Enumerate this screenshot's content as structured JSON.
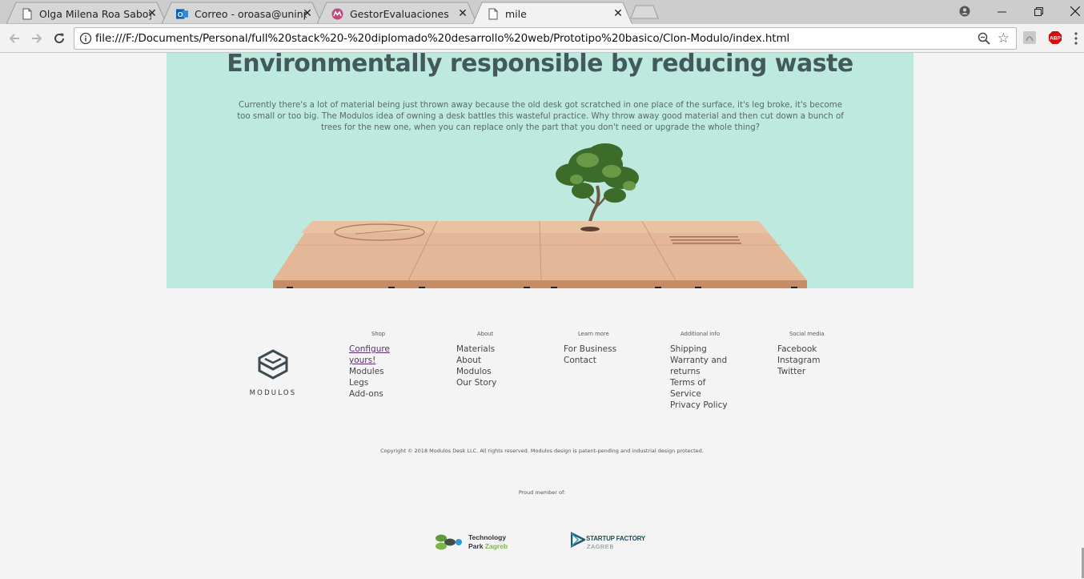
{
  "browser": {
    "tabs": [
      {
        "title": "Olga Milena Roa Saboya",
        "icon": "document-icon",
        "active": false
      },
      {
        "title": "Correo - oroasa@uninpal",
        "icon": "outlook-icon",
        "active": false
      },
      {
        "title": "GestorEvaluaciones",
        "icon": "gestor-icon",
        "active": false
      },
      {
        "title": "mile",
        "icon": "document-icon",
        "active": true
      }
    ],
    "close_glyph": "✕",
    "url": "file:///F:/Documents/Personal/full%20stack%20-%20diplomado%20desarrollo%20web/Prototipo%20basico/Clon-Modulo/index.html",
    "abp_label": "ABP"
  },
  "hero": {
    "title": "Environmentally responsible by reducing waste",
    "text": "Currently there's a lot of material being just thrown away because the old desk got scratched in one place of the surface, it's leg broke, it's become too small or too big. The Modulos idea of owning a desk battles this wasteful practice. Why throw away good material and then cut down a bunch of trees for the new one, when you can replace only the part that you don't need or upgrade the whole thing?"
  },
  "footer": {
    "brand": "MODULOS",
    "columns": [
      {
        "title": "Shop",
        "links": [
          "Configure yours!",
          "Modules",
          "Legs",
          "Add-ons"
        ]
      },
      {
        "title": "About",
        "links": [
          "Materials",
          "About Modulos",
          "Our Story"
        ]
      },
      {
        "title": "Learn more",
        "links": [
          "For Business",
          "Contact"
        ]
      },
      {
        "title": "Additional info",
        "links": [
          "Shipping",
          "Warranty and returns",
          "Terms of Service",
          "Privacy Policy"
        ]
      },
      {
        "title": "Social media",
        "links": [
          "Facebook",
          "Instagram",
          "Twitter"
        ]
      }
    ],
    "copyright": "Copyright © 2018 Modulos Desk LLC. All rights reserved. Modulos design is patent-pending and industrial design protected.",
    "member_label": "Proud member of:",
    "partners": {
      "tpz_line1": "Technology",
      "tpz_line2a": "Park ",
      "tpz_line2b": "Zagreb",
      "sf_name": "STARTUP FACTORY",
      "sf_city": "ZAGREB"
    }
  }
}
